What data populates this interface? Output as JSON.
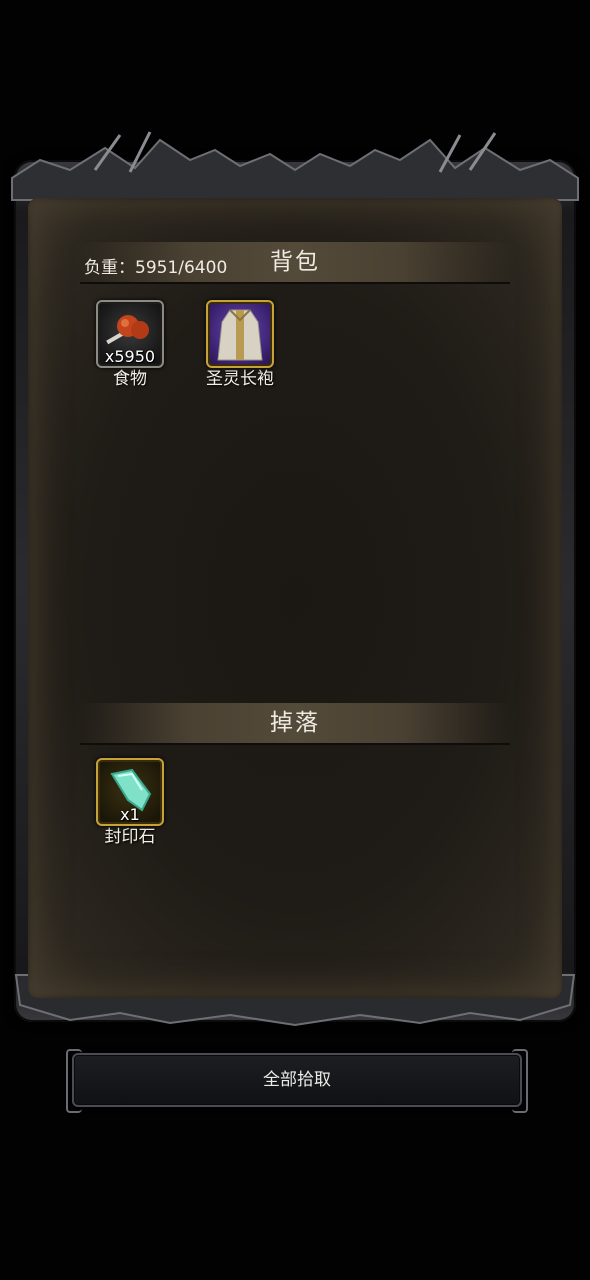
{
  "bag": {
    "title": "背包",
    "weight_label": "负重：5951/6400",
    "items": [
      {
        "name": "食物",
        "count": "x5950",
        "icon": "meat-icon"
      },
      {
        "name": "圣灵长袍",
        "count": "",
        "icon": "robe-icon"
      }
    ]
  },
  "drops": {
    "title": "掉落",
    "items": [
      {
        "name": "封印石",
        "count": "x1",
        "icon": "crystal-icon"
      }
    ]
  },
  "actions": {
    "pickup_all_label": "全部拾取"
  }
}
